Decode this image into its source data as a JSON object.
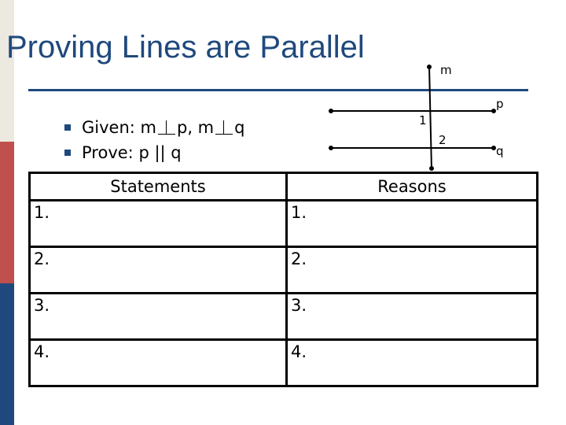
{
  "colors": {
    "title": "#1F497D",
    "rule": "#1F497D",
    "bullet": "#1F497D",
    "sidebar": [
      "#ECE9E0",
      "#C0504D",
      "#1F497D"
    ]
  },
  "title": "Proving Lines are Parallel",
  "bullets": [
    {
      "label": "Given:",
      "parts": [
        "m",
        "p, m",
        "q"
      ]
    },
    {
      "label": "Prove:",
      "text": "p || q"
    }
  ],
  "diagram": {
    "labels": {
      "m": "m",
      "p": "p",
      "q": "q",
      "angle1": "1",
      "angle2": "2"
    }
  },
  "table": {
    "headers": [
      "Statements",
      "Reasons"
    ],
    "rows": [
      {
        "statement": "1.",
        "reason": "1."
      },
      {
        "statement": "2.",
        "reason": "2."
      },
      {
        "statement": "3.",
        "reason": "3."
      },
      {
        "statement": "4.",
        "reason": "4."
      }
    ]
  }
}
